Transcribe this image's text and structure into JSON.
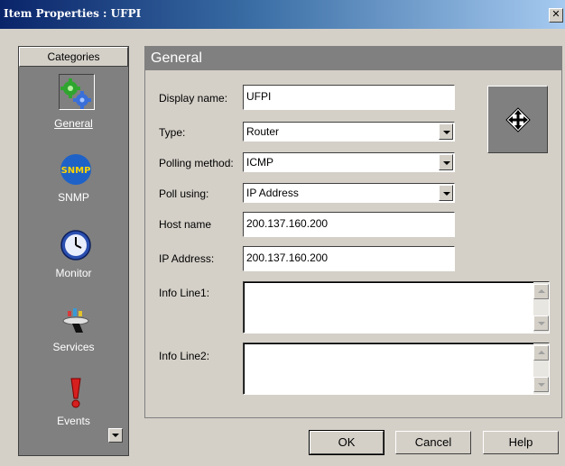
{
  "window": {
    "title": "Item Properties : UFPI",
    "close_symbol": "✕"
  },
  "sidebar": {
    "header": "Categories",
    "items": [
      {
        "label": "General",
        "icon": "gears-icon",
        "selected": true
      },
      {
        "label": "SNMP",
        "icon": "snmp-icon",
        "selected": false
      },
      {
        "label": "Monitor",
        "icon": "clock-icon",
        "selected": false
      },
      {
        "label": "Services",
        "icon": "services-tray-icon",
        "selected": false
      },
      {
        "label": "Events",
        "icon": "exclamation-icon",
        "selected": false
      }
    ]
  },
  "panel": {
    "title": "General",
    "display_name": {
      "label": "Display name:",
      "value": "UFPI"
    },
    "type": {
      "label": "Type:",
      "value": "Router"
    },
    "polling_method": {
      "label": "Polling method:",
      "value": "ICMP"
    },
    "poll_using": {
      "label": "Poll using:",
      "value": "IP Address"
    },
    "host_name": {
      "label": "Host name",
      "value": "200.137.160.200"
    },
    "ip_address": {
      "label": "IP Address:",
      "value": "200.137.160.200"
    },
    "info_line1": {
      "label": "Info Line1:",
      "value": ""
    },
    "info_line2": {
      "label": "Info Line2:",
      "value": ""
    },
    "device_icon": "router-arrows-icon"
  },
  "buttons": {
    "ok": "OK",
    "cancel": "Cancel",
    "help": "Help"
  },
  "colors": {
    "title_gradient_start": "#0a246a",
    "title_gradient_end": "#a6caf0",
    "dialog_face": "#d4d0c8",
    "sidebar_bg": "#808080"
  }
}
